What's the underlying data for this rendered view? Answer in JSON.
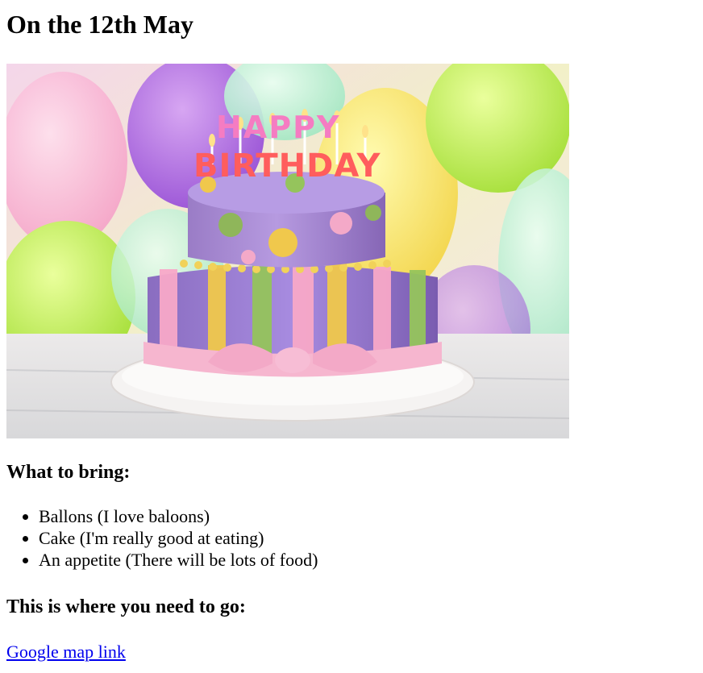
{
  "heading": "On the 12th May",
  "image": {
    "cake_topper_line1": "HAPPY",
    "cake_topper_line2": "BIRTHDAY"
  },
  "bring": {
    "heading": "What to bring:",
    "items": [
      "Ballons (I love baloons)",
      "Cake (I'm really good at eating)",
      "An appetite (There will be lots of food)"
    ]
  },
  "where": {
    "heading": "This is where you need to go:",
    "link_label": "Google map link"
  }
}
